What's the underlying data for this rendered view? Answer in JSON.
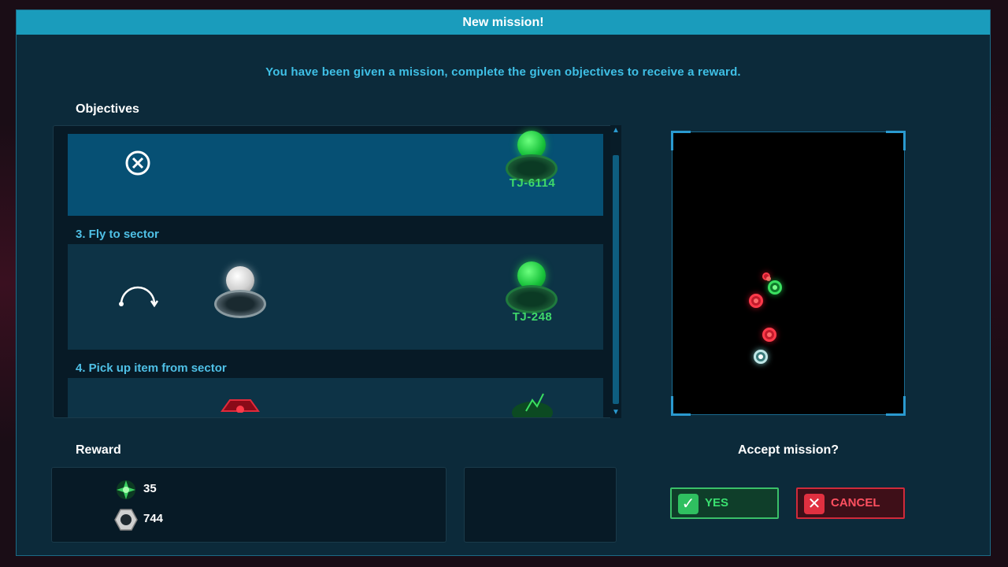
{
  "dialog": {
    "title": "New mission!",
    "intro": "You have been given a mission, complete the given objectives to receive a reward."
  },
  "objectives": {
    "heading": "Objectives",
    "items": [
      {
        "label": "",
        "icon": "cancel-x-icon",
        "target": "TJ-6114"
      },
      {
        "label": "3. Fly to sector",
        "icon": "jump-arc-icon",
        "origin_color": "white",
        "target": "TJ-248"
      },
      {
        "label": "4. Pick up item from sector",
        "icon": "pickup-item-icon"
      }
    ]
  },
  "reward": {
    "heading": "Reward",
    "items": [
      {
        "icon": "xp-star-icon",
        "value": "35",
        "color": "#3ad060"
      },
      {
        "icon": "hex-nut-icon",
        "value": "744",
        "color": "#d0d0d0"
      }
    ]
  },
  "accept": {
    "question": "Accept mission?",
    "yes_label": "YES",
    "cancel_label": "CANCEL"
  },
  "colors": {
    "accent": "#1a9cbc",
    "panel": "#0c2a3a",
    "green": "#3ae070",
    "red": "#ff5060"
  }
}
